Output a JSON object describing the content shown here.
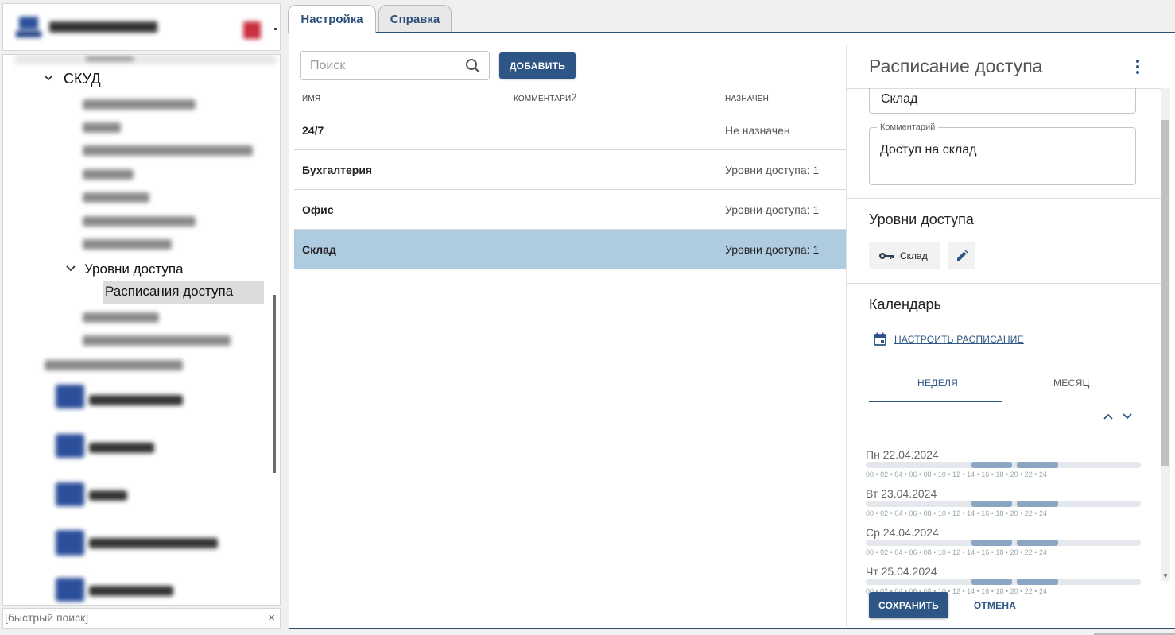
{
  "tree": {
    "node_skud": "СКУД",
    "node_access_levels": "Уровни доступа",
    "node_schedules": "Расписания доступа"
  },
  "quick_search": {
    "placeholder": "[быстрый поиск]",
    "clear": "×"
  },
  "tabs": [
    {
      "label": "Настройка",
      "active": true
    },
    {
      "label": "Справка",
      "active": false
    }
  ],
  "toolbar": {
    "search_placeholder": "Поиск",
    "add_label": "ДОБАВИТЬ"
  },
  "table": {
    "columns": {
      "name": "ИМЯ",
      "comment": "КОММЕНТАРИЙ",
      "assigned": "НАЗНАЧЕН"
    },
    "rows": [
      {
        "name": "24/7",
        "comment": "",
        "assigned": "Не назначен",
        "selected": false
      },
      {
        "name": "Бухгалтерия",
        "comment": "",
        "assigned": "Уровни доступа: 1",
        "selected": false
      },
      {
        "name": "Офис",
        "comment": "",
        "assigned": "Уровни доступа: 1",
        "selected": false
      },
      {
        "name": "Склад",
        "comment": "",
        "assigned": "Уровни доступа: 1",
        "selected": true
      }
    ]
  },
  "detail": {
    "title": "Расписание доступа",
    "name_value": "Склад",
    "comment_label": "Комментарий",
    "comment_value": "Доступ на склад",
    "levels_title": "Уровни доступа",
    "level_chip": "Склад",
    "calendar_title": "Календарь",
    "configure_link": "НАСТРОИТЬ РАСПИСАНИЕ",
    "view_tabs": {
      "week": "НЕДЕЛЯ",
      "month": "МЕСЯЦ",
      "active": "week"
    },
    "tick_labels": [
      "00",
      "02",
      "04",
      "06",
      "08",
      "10",
      "12",
      "14",
      "16",
      "18",
      "20",
      "22",
      "24"
    ],
    "days": [
      {
        "label": "Пн 22.04.2024",
        "intervals": [
          [
            9,
            13
          ],
          [
            13,
            17
          ]
        ]
      },
      {
        "label": "Вт 23.04.2024",
        "intervals": [
          [
            9,
            13
          ],
          [
            13,
            17
          ]
        ]
      },
      {
        "label": "Ср 24.04.2024",
        "intervals": [
          [
            9,
            13
          ],
          [
            13,
            17
          ]
        ]
      },
      {
        "label": "Чт 25.04.2024",
        "intervals": [
          [
            9,
            13
          ],
          [
            13,
            17
          ]
        ]
      }
    ],
    "save_label": "СОХРАНИТЬ",
    "cancel_label": "ОТМЕНА"
  },
  "colors": {
    "accent": "#2d5585",
    "selected_row": "#aecbe0",
    "interval": "#8aa6c2"
  }
}
